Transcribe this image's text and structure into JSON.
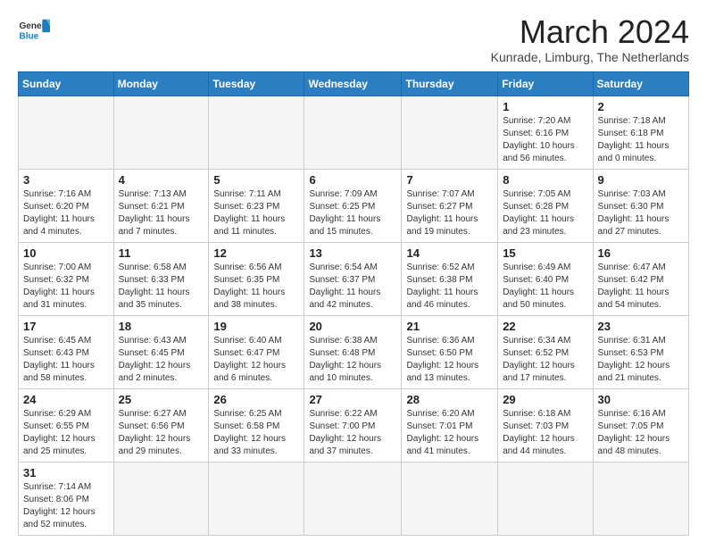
{
  "header": {
    "logo_general": "General",
    "logo_blue": "Blue",
    "month_title": "March 2024",
    "location": "Kunrade, Limburg, The Netherlands"
  },
  "weekdays": [
    "Sunday",
    "Monday",
    "Tuesday",
    "Wednesday",
    "Thursday",
    "Friday",
    "Saturday"
  ],
  "weeks": [
    [
      {
        "day": "",
        "info": ""
      },
      {
        "day": "",
        "info": ""
      },
      {
        "day": "",
        "info": ""
      },
      {
        "day": "",
        "info": ""
      },
      {
        "day": "",
        "info": ""
      },
      {
        "day": "1",
        "info": "Sunrise: 7:20 AM\nSunset: 6:16 PM\nDaylight: 10 hours and 56 minutes."
      },
      {
        "day": "2",
        "info": "Sunrise: 7:18 AM\nSunset: 6:18 PM\nDaylight: 11 hours and 0 minutes."
      }
    ],
    [
      {
        "day": "3",
        "info": "Sunrise: 7:16 AM\nSunset: 6:20 PM\nDaylight: 11 hours and 4 minutes."
      },
      {
        "day": "4",
        "info": "Sunrise: 7:13 AM\nSunset: 6:21 PM\nDaylight: 11 hours and 7 minutes."
      },
      {
        "day": "5",
        "info": "Sunrise: 7:11 AM\nSunset: 6:23 PM\nDaylight: 11 hours and 11 minutes."
      },
      {
        "day": "6",
        "info": "Sunrise: 7:09 AM\nSunset: 6:25 PM\nDaylight: 11 hours and 15 minutes."
      },
      {
        "day": "7",
        "info": "Sunrise: 7:07 AM\nSunset: 6:27 PM\nDaylight: 11 hours and 19 minutes."
      },
      {
        "day": "8",
        "info": "Sunrise: 7:05 AM\nSunset: 6:28 PM\nDaylight: 11 hours and 23 minutes."
      },
      {
        "day": "9",
        "info": "Sunrise: 7:03 AM\nSunset: 6:30 PM\nDaylight: 11 hours and 27 minutes."
      }
    ],
    [
      {
        "day": "10",
        "info": "Sunrise: 7:00 AM\nSunset: 6:32 PM\nDaylight: 11 hours and 31 minutes."
      },
      {
        "day": "11",
        "info": "Sunrise: 6:58 AM\nSunset: 6:33 PM\nDaylight: 11 hours and 35 minutes."
      },
      {
        "day": "12",
        "info": "Sunrise: 6:56 AM\nSunset: 6:35 PM\nDaylight: 11 hours and 38 minutes."
      },
      {
        "day": "13",
        "info": "Sunrise: 6:54 AM\nSunset: 6:37 PM\nDaylight: 11 hours and 42 minutes."
      },
      {
        "day": "14",
        "info": "Sunrise: 6:52 AM\nSunset: 6:38 PM\nDaylight: 11 hours and 46 minutes."
      },
      {
        "day": "15",
        "info": "Sunrise: 6:49 AM\nSunset: 6:40 PM\nDaylight: 11 hours and 50 minutes."
      },
      {
        "day": "16",
        "info": "Sunrise: 6:47 AM\nSunset: 6:42 PM\nDaylight: 11 hours and 54 minutes."
      }
    ],
    [
      {
        "day": "17",
        "info": "Sunrise: 6:45 AM\nSunset: 6:43 PM\nDaylight: 11 hours and 58 minutes."
      },
      {
        "day": "18",
        "info": "Sunrise: 6:43 AM\nSunset: 6:45 PM\nDaylight: 12 hours and 2 minutes."
      },
      {
        "day": "19",
        "info": "Sunrise: 6:40 AM\nSunset: 6:47 PM\nDaylight: 12 hours and 6 minutes."
      },
      {
        "day": "20",
        "info": "Sunrise: 6:38 AM\nSunset: 6:48 PM\nDaylight: 12 hours and 10 minutes."
      },
      {
        "day": "21",
        "info": "Sunrise: 6:36 AM\nSunset: 6:50 PM\nDaylight: 12 hours and 13 minutes."
      },
      {
        "day": "22",
        "info": "Sunrise: 6:34 AM\nSunset: 6:52 PM\nDaylight: 12 hours and 17 minutes."
      },
      {
        "day": "23",
        "info": "Sunrise: 6:31 AM\nSunset: 6:53 PM\nDaylight: 12 hours and 21 minutes."
      }
    ],
    [
      {
        "day": "24",
        "info": "Sunrise: 6:29 AM\nSunset: 6:55 PM\nDaylight: 12 hours and 25 minutes."
      },
      {
        "day": "25",
        "info": "Sunrise: 6:27 AM\nSunset: 6:56 PM\nDaylight: 12 hours and 29 minutes."
      },
      {
        "day": "26",
        "info": "Sunrise: 6:25 AM\nSunset: 6:58 PM\nDaylight: 12 hours and 33 minutes."
      },
      {
        "day": "27",
        "info": "Sunrise: 6:22 AM\nSunset: 7:00 PM\nDaylight: 12 hours and 37 minutes."
      },
      {
        "day": "28",
        "info": "Sunrise: 6:20 AM\nSunset: 7:01 PM\nDaylight: 12 hours and 41 minutes."
      },
      {
        "day": "29",
        "info": "Sunrise: 6:18 AM\nSunset: 7:03 PM\nDaylight: 12 hours and 44 minutes."
      },
      {
        "day": "30",
        "info": "Sunrise: 6:16 AM\nSunset: 7:05 PM\nDaylight: 12 hours and 48 minutes."
      }
    ],
    [
      {
        "day": "31",
        "info": "Sunrise: 7:14 AM\nSunset: 8:06 PM\nDaylight: 12 hours and 52 minutes."
      },
      {
        "day": "",
        "info": ""
      },
      {
        "day": "",
        "info": ""
      },
      {
        "day": "",
        "info": ""
      },
      {
        "day": "",
        "info": ""
      },
      {
        "day": "",
        "info": ""
      },
      {
        "day": "",
        "info": ""
      }
    ]
  ]
}
